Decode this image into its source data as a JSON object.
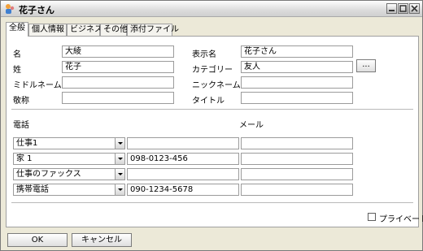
{
  "window": {
    "title": "花子さん"
  },
  "tabs": [
    "全般",
    "個人情報",
    "ビジネス",
    "その他",
    "添付ファイル"
  ],
  "general": {
    "labels": {
      "first_name": "名",
      "last_name": "姓",
      "middle_name": "ミドルネーム",
      "honorific": "敬称",
      "display_name": "表示名",
      "category": "カテゴリー",
      "nickname": "ニックネーム",
      "job_title": "タイトル"
    },
    "values": {
      "first_name": "大綾",
      "last_name": "花子",
      "middle_name": "",
      "honorific": "",
      "display_name": "花子さん",
      "category": "友人",
      "nickname": "",
      "job_title": ""
    },
    "category_button": "...",
    "phone_header": "電話",
    "email_header": "メール",
    "phones": [
      {
        "type": "仕事1",
        "number": "",
        "email": ""
      },
      {
        "type": "家 1",
        "number": "098-0123-456",
        "email": ""
      },
      {
        "type": "仕事のファックス",
        "number": "",
        "email": ""
      },
      {
        "type": "携帯電話",
        "number": "090-1234-5678",
        "email": ""
      }
    ],
    "private_label": "プライベート"
  },
  "footer": {
    "ok": "OK",
    "cancel": "キャンセル"
  }
}
